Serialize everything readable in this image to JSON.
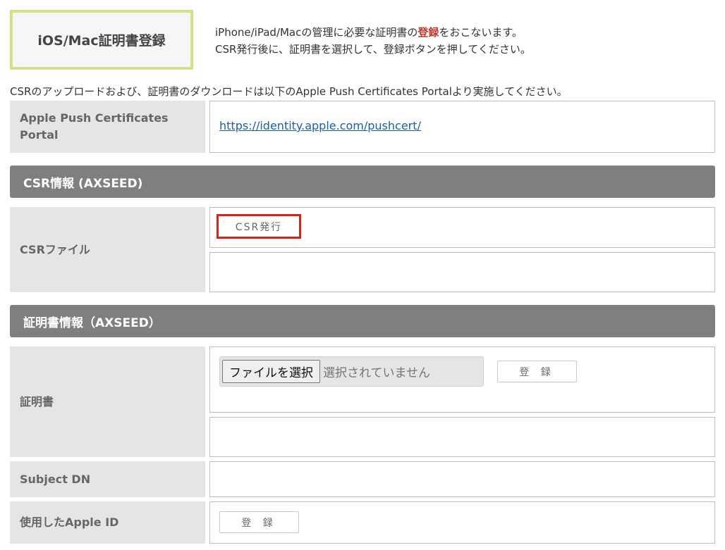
{
  "header": {
    "title": "iOS/Mac証明書登録",
    "intro_line1_before": "iPhone/iPad/Macの管理に必要な証明書の",
    "intro_line1_emphasis": "登録",
    "intro_line1_after": "をおこないます。",
    "intro_line2": "CSR発行後に、証明書を選択して、登録ボタンを押してください。"
  },
  "notice": "CSRのアップロードおよび、証明書のダウンロードは以下のApple Push Certificates Portalより実施してください。",
  "portal": {
    "label": "Apple Push Certificates Portal",
    "url": "https://identity.apple.com/pushcert/"
  },
  "csr_section": {
    "header": "CSR情報 (AXSEED)",
    "file_label": "CSRファイル",
    "issue_button": "CSR発行"
  },
  "cert_section": {
    "header": "証明書情報（AXSEED）",
    "cert_label": "証明書",
    "file_button": "ファイルを選択",
    "file_status": "選択されていません",
    "register_button": "登 録",
    "subject_dn_label": "Subject DN",
    "subject_dn_value": "",
    "apple_id_label": "使用したApple ID",
    "apple_id_register_button": "登 録"
  },
  "colors": {
    "title_border": "#d4e286",
    "section_header_bg": "#7f7f7f",
    "label_bg": "#e5e5e5",
    "link": "#1a5ea8",
    "highlight_border": "#e0201b",
    "emphasis_text": "#c0392b"
  }
}
